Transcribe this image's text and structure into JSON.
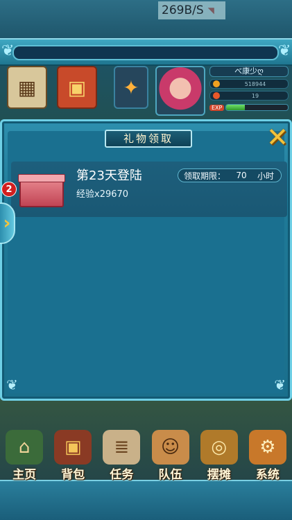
{
  "status": {
    "net_speed": "269B/S"
  },
  "hud": {
    "icons": [
      "calendar-icon",
      "treasure-chest-icon",
      "pet-icon"
    ],
    "player": {
      "name": "べ康少ღ",
      "gold": "518944",
      "gems": "19",
      "exp_label": "EXP",
      "exp_progress": 0.3
    }
  },
  "dialog": {
    "title": "礼物领取",
    "gift": {
      "badge": "2",
      "title": "第23天登陆",
      "reward": "经验x29670",
      "expire_label": "领取期限：",
      "expire_value": "70",
      "expire_unit": "小时"
    }
  },
  "nav": [
    {
      "label": "主页",
      "icon": "home-icon"
    },
    {
      "label": "背包",
      "icon": "backpack-icon"
    },
    {
      "label": "任务",
      "icon": "scroll-icon"
    },
    {
      "label": "队伍",
      "icon": "team-icon"
    },
    {
      "label": "摆摊",
      "icon": "stall-icon"
    },
    {
      "label": "系统",
      "icon": "gear-icon"
    }
  ],
  "colors": {
    "accent": "#6fd0e6",
    "gold": "#f3c23a",
    "badge": "#d21f1f"
  }
}
